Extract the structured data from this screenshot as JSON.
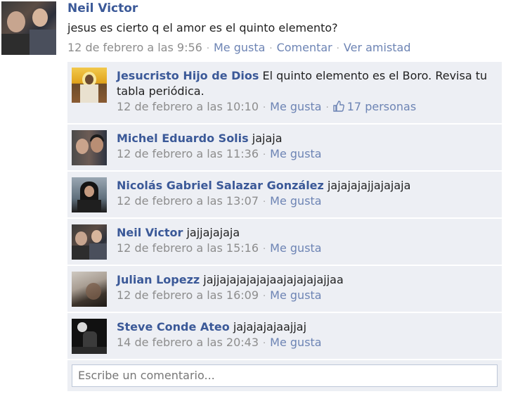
{
  "post": {
    "author": "Neil Victor",
    "text": "jesus es cierto q el amor es el quinto elemento?",
    "timestamp": "12 de febrero a las 9:56",
    "actions": [
      "Me gusta",
      "Comentar",
      "Ver amistad"
    ]
  },
  "comments": [
    {
      "author": "Jesucristo Hijo de Dios",
      "text": "El quinto elemento es el Boro. Revisa tu tabla periódica.",
      "timestamp": "12 de febrero a las 10:10",
      "like_label": "Me gusta",
      "likes": "17 personas",
      "avatar_icon": "jesus-profile-photo"
    },
    {
      "author": "Michel Eduardo Solis",
      "text": "jajaja",
      "timestamp": "12 de febrero a las 11:36",
      "like_label": "Me gusta",
      "avatar_icon": "couple-profile-photo"
    },
    {
      "author": "Nicolás Gabriel Salazar González",
      "text": "jajajajajjajajaja",
      "timestamp": "12 de febrero a las 13:07",
      "like_label": "Me gusta",
      "avatar_icon": "long-hair-profile-photo"
    },
    {
      "author": "Neil Victor",
      "text": "jajjajajaja",
      "timestamp": "12 de febrero a las 15:16",
      "like_label": "Me gusta",
      "avatar_icon": "two-men-profile-photo"
    },
    {
      "author": "Julian Lopezz",
      "text": "jajjajajajajajaajajajajajjaa",
      "timestamp": "12 de febrero a las 16:09",
      "like_label": "Me gusta",
      "avatar_icon": "blurry-profile-photo"
    },
    {
      "author": "Steve Conde Ateo",
      "text": "jajajajajaajjaj",
      "timestamp": "14 de febrero a las 20:43",
      "like_label": "Me gusta",
      "avatar_icon": "dark-moon-profile-photo"
    }
  ],
  "comment_box": {
    "placeholder": "Escribe un comentario..."
  },
  "colors": {
    "name_blue": "#3b5998",
    "link_blue": "#6d84b4",
    "comment_bg": "#edeff4",
    "meta_gray": "#8d8d8d"
  }
}
